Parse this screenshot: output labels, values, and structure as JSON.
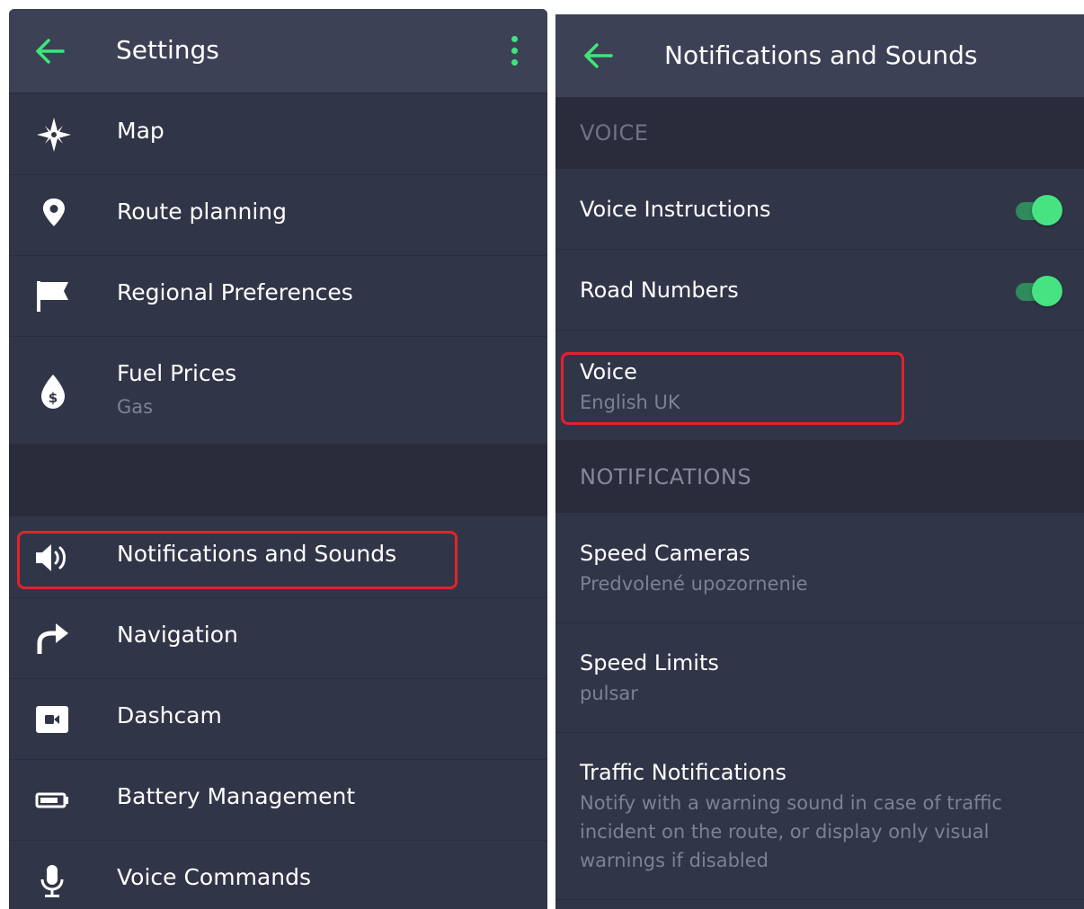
{
  "left_panel": {
    "title": "Settings",
    "back_icon": "arrow-left-icon",
    "menu_icon": "more-vertical-icon",
    "accent_color": "#3ee67a",
    "items": [
      {
        "label": "Map",
        "icon": "compass-star-icon"
      },
      {
        "label": "Route planning",
        "icon": "location-pin-icon"
      },
      {
        "label": "Regional Preferences",
        "icon": "flag-icon"
      },
      {
        "label": "Fuel Prices",
        "sub": "Gas",
        "icon": "fuel-drop-icon"
      },
      {
        "label": "Notifications and Sounds",
        "icon": "speaker-icon",
        "highlighted": true
      },
      {
        "label": "Navigation",
        "icon": "turn-right-arrow-icon"
      },
      {
        "label": "Dashcam",
        "icon": "camera-icon"
      },
      {
        "label": "Battery Management",
        "icon": "battery-icon"
      },
      {
        "label": "Voice Commands",
        "icon": "microphone-icon"
      }
    ]
  },
  "right_panel": {
    "title": "Notifications and Sounds",
    "back_icon": "arrow-left-icon",
    "sections": {
      "voice": "VOICE",
      "notifications": "NOTIFICATIONS"
    },
    "voice_instructions": {
      "label": "Voice Instructions",
      "enabled": true
    },
    "road_numbers": {
      "label": "Road Numbers",
      "enabled": true
    },
    "voice": {
      "label": "Voice",
      "value": "English UK",
      "highlighted": true
    },
    "speed_cameras": {
      "label": "Speed Cameras",
      "value": "Predvolené upozornenie"
    },
    "speed_limits": {
      "label": "Speed Limits",
      "value": "pulsar"
    },
    "traffic_notifications": {
      "label": "Traffic Notifications",
      "description": "Notify with a warning sound in case of traffic incident on the route, or display only visual warnings if disabled"
    }
  },
  "colors": {
    "background": "#313548",
    "header": "#3d4155",
    "section": "#2a2c3b",
    "toggle_on": "#47e383",
    "highlight": "#e0232c"
  }
}
